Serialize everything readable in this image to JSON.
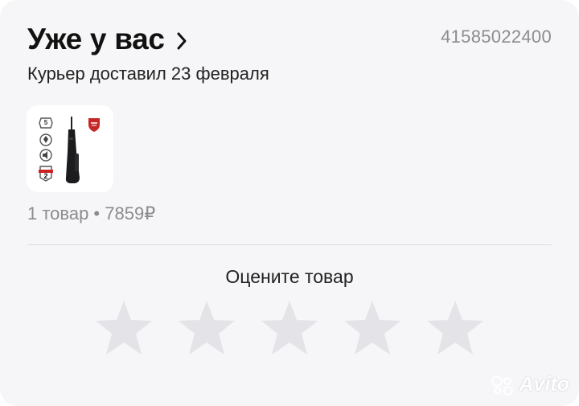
{
  "order": {
    "title": "Уже у вас",
    "number": "41585022400",
    "status": "Курьер доставил 23 февраля",
    "summary": "1 товар • 7859₽"
  },
  "rating": {
    "label": "Оцените товар",
    "max_stars": 5,
    "selected": 0,
    "star_color": "#e3e3e8"
  },
  "product": {
    "image_icon": "oral-irrigator-product-image"
  },
  "watermark": {
    "text": "Avito"
  }
}
